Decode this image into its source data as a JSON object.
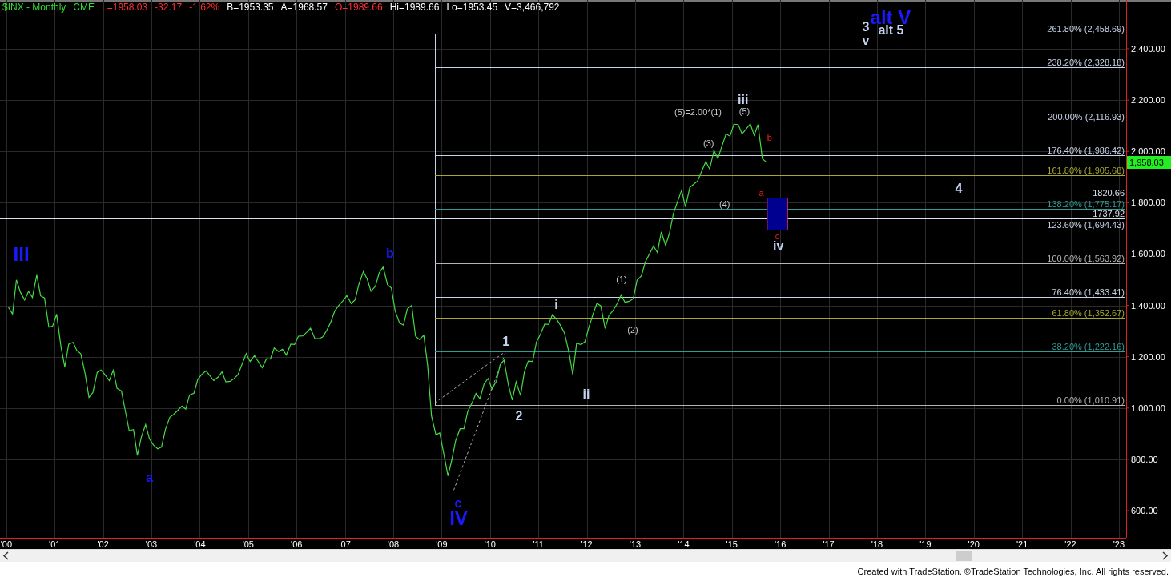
{
  "header": {
    "items": [
      {
        "text": "$INX - Monthly",
        "color": "#33dd33"
      },
      {
        "text": "CME",
        "color": "#33dd33"
      },
      {
        "text": "L=1958.03",
        "color": "#ff3030"
      },
      {
        "text": "-32.17",
        "color": "#ff3030"
      },
      {
        "text": "-1.62%",
        "color": "#ff3030"
      },
      {
        "text": "B=1953.35",
        "color": "#ffffff"
      },
      {
        "text": "A=1968.57",
        "color": "#ffffff"
      },
      {
        "text": "O=1989.66",
        "color": "#ff3030"
      },
      {
        "text": "Hi=1989.66",
        "color": "#ffffff"
      },
      {
        "text": "Lo=1953.45",
        "color": "#ffffff"
      },
      {
        "text": "V=3,466,792",
        "color": "#ffffff"
      }
    ]
  },
  "chart": {
    "chart_data": {
      "type": "line",
      "xlim": [
        1999.87,
        2023.15
      ],
      "ylim": [
        494,
        2590
      ],
      "x": [
        2000.04,
        2000.13,
        2000.21,
        2000.29,
        2000.38,
        2000.46,
        2000.54,
        2000.63,
        2000.71,
        2000.79,
        2000.88,
        2000.96,
        2001.04,
        2001.13,
        2001.21,
        2001.29,
        2001.38,
        2001.46,
        2001.54,
        2001.63,
        2001.71,
        2001.79,
        2001.88,
        2001.96,
        2002.04,
        2002.13,
        2002.21,
        2002.29,
        2002.38,
        2002.46,
        2002.54,
        2002.63,
        2002.71,
        2002.79,
        2002.88,
        2002.96,
        2003.04,
        2003.13,
        2003.21,
        2003.29,
        2003.38,
        2003.46,
        2003.54,
        2003.63,
        2003.71,
        2003.79,
        2003.88,
        2003.96,
        2004.04,
        2004.13,
        2004.21,
        2004.29,
        2004.38,
        2004.46,
        2004.54,
        2004.63,
        2004.71,
        2004.79,
        2004.88,
        2004.96,
        2005.04,
        2005.13,
        2005.21,
        2005.29,
        2005.38,
        2005.46,
        2005.54,
        2005.63,
        2005.71,
        2005.79,
        2005.88,
        2005.96,
        2006.04,
        2006.13,
        2006.21,
        2006.29,
        2006.38,
        2006.46,
        2006.54,
        2006.63,
        2006.71,
        2006.79,
        2006.88,
        2006.96,
        2007.04,
        2007.13,
        2007.21,
        2007.29,
        2007.38,
        2007.46,
        2007.54,
        2007.63,
        2007.71,
        2007.79,
        2007.88,
        2007.96,
        2008.04,
        2008.13,
        2008.21,
        2008.29,
        2008.38,
        2008.46,
        2008.54,
        2008.63,
        2008.71,
        2008.79,
        2008.88,
        2008.96,
        2009.04,
        2009.13,
        2009.21,
        2009.29,
        2009.38,
        2009.46,
        2009.54,
        2009.63,
        2009.71,
        2009.79,
        2009.88,
        2009.96,
        2010.04,
        2010.13,
        2010.21,
        2010.29,
        2010.38,
        2010.46,
        2010.54,
        2010.63,
        2010.71,
        2010.79,
        2010.88,
        2010.96,
        2011.04,
        2011.13,
        2011.21,
        2011.29,
        2011.38,
        2011.46,
        2011.54,
        2011.63,
        2011.71,
        2011.79,
        2011.88,
        2011.96,
        2012.04,
        2012.13,
        2012.21,
        2012.29,
        2012.38,
        2012.46,
        2012.54,
        2012.63,
        2012.71,
        2012.79,
        2012.88,
        2012.96,
        2013.04,
        2013.13,
        2013.21,
        2013.29,
        2013.38,
        2013.46,
        2013.54,
        2013.63,
        2013.71,
        2013.79,
        2013.88,
        2013.96,
        2014.04,
        2014.13,
        2014.21,
        2014.29,
        2014.38,
        2014.46,
        2014.54,
        2014.63,
        2014.71,
        2014.79,
        2014.88,
        2014.96,
        2015.04,
        2015.13,
        2015.21,
        2015.29,
        2015.38,
        2015.46,
        2015.54,
        2015.63,
        2015.71
      ],
      "xticks": [
        {
          "value": 2000,
          "label": "'00"
        },
        {
          "value": 2001,
          "label": "'01"
        },
        {
          "value": 2002,
          "label": "'02"
        },
        {
          "value": 2003,
          "label": "'03"
        },
        {
          "value": 2004,
          "label": "'04"
        },
        {
          "value": 2005,
          "label": "'05"
        },
        {
          "value": 2006,
          "label": "'06"
        },
        {
          "value": 2007,
          "label": "'07"
        },
        {
          "value": 2008,
          "label": "'08"
        },
        {
          "value": 2009,
          "label": "'09"
        },
        {
          "value": 2010,
          "label": "'10"
        },
        {
          "value": 2011,
          "label": "'11"
        },
        {
          "value": 2012,
          "label": "'12"
        },
        {
          "value": 2013,
          "label": "'13"
        },
        {
          "value": 2014,
          "label": "'14"
        },
        {
          "value": 2015,
          "label": "'15"
        },
        {
          "value": 2016,
          "label": "'16"
        },
        {
          "value": 2017,
          "label": "'17"
        },
        {
          "value": 2018,
          "label": "'18"
        },
        {
          "value": 2019,
          "label": "'19"
        },
        {
          "value": 2020,
          "label": "'20"
        },
        {
          "value": 2021,
          "label": "'21"
        },
        {
          "value": 2022,
          "label": "'22"
        },
        {
          "value": 2023,
          "label": "'23"
        }
      ],
      "yticks": [
        {
          "value": 600,
          "label": "600.00"
        },
        {
          "value": 800,
          "label": "800.00"
        },
        {
          "value": 1000,
          "label": "1,000.00"
        },
        {
          "value": 1200,
          "label": "1,200.00"
        },
        {
          "value": 1400,
          "label": "1,400.00"
        },
        {
          "value": 1600,
          "label": "1,600.00"
        },
        {
          "value": 1800,
          "label": "1,800.00"
        },
        {
          "value": 2000,
          "label": "2,000.00"
        },
        {
          "value": 2200,
          "label": "2,200.00"
        },
        {
          "value": 2400,
          "label": "2,400.00"
        }
      ],
      "series": [
        {
          "color": "#44dd44",
          "values": [
            1394,
            1366,
            1499,
            1452,
            1421,
            1455,
            1431,
            1518,
            1437,
            1429,
            1315,
            1320,
            1366,
            1240,
            1160,
            1249,
            1256,
            1224,
            1211,
            1134,
            1041,
            1060,
            1139,
            1148,
            1130,
            1107,
            1147,
            1076,
            1067,
            990,
            912,
            916,
            815,
            886,
            936,
            880,
            856,
            841,
            848,
            917,
            964,
            975,
            990,
            1008,
            996,
            1051,
            1058,
            1112,
            1131,
            1145,
            1126,
            1107,
            1121,
            1141,
            1102,
            1104,
            1115,
            1130,
            1174,
            1212,
            1181,
            1204,
            1181,
            1157,
            1192,
            1191,
            1234,
            1220,
            1229,
            1207,
            1249,
            1248,
            1280,
            1281,
            1295,
            1311,
            1270,
            1270,
            1277,
            1304,
            1336,
            1378,
            1401,
            1418,
            1438,
            1407,
            1421,
            1482,
            1531,
            1503,
            1455,
            1474,
            1527,
            1549,
            1481,
            1468,
            1378,
            1331,
            1323,
            1386,
            1400,
            1280,
            1267,
            1283,
            1166,
            969,
            896,
            903,
            826,
            735,
            798,
            873,
            919,
            919,
            987,
            1021,
            1057,
            1036,
            1096,
            1115,
            1074,
            1104,
            1169,
            1187,
            1089,
            1031,
            1102,
            1049,
            1141,
            1183,
            1181,
            1258,
            1286,
            1327,
            1326,
            1364,
            1345,
            1321,
            1292,
            1219,
            1131,
            1253,
            1247,
            1258,
            1312,
            1366,
            1408,
            1398,
            1310,
            1362,
            1379,
            1407,
            1441,
            1412,
            1416,
            1426,
            1498,
            1515,
            1569,
            1598,
            1631,
            1606,
            1686,
            1633,
            1682,
            1757,
            1806,
            1848,
            1783,
            1859,
            1872,
            1884,
            1924,
            1960,
            1931,
            2003,
            1972,
            2018,
            2068,
            2059,
            2105,
            2105,
            2068,
            2086,
            2107,
            2063,
            2104,
            1972,
            1958
          ]
        }
      ],
      "grid": true,
      "ref_lines": [
        {
          "axis": "y",
          "value": 2458.69,
          "label": "261.80% (2,458.69)",
          "color": "#c8d2e6"
        },
        {
          "axis": "y",
          "value": 2328.18,
          "label": "238.20% (2,328.18)",
          "color": "#c8d2e6"
        },
        {
          "axis": "y",
          "value": 2116.93,
          "label": "200.00% (2,116.93)",
          "color": "#c8d2e6"
        },
        {
          "axis": "y",
          "value": 1986.42,
          "label": "176.40% (1,986.42)",
          "color": "#c8d2e6"
        },
        {
          "axis": "y",
          "value": 1905.68,
          "label": "161.80% (1,905.68)",
          "color": "#a8a830"
        },
        {
          "axis": "y",
          "value": 1820.66,
          "label": "1820.66",
          "color": "#d8e0ee"
        },
        {
          "axis": "y",
          "value": 1775.17,
          "label": "138.20% (1,775.17)",
          "color": "#2e9c94"
        },
        {
          "axis": "y",
          "value": 1737.92,
          "label": "1737.92",
          "color": "#d8e0ee"
        },
        {
          "axis": "y",
          "value": 1694.43,
          "label": "123.60% (1,694.43)",
          "color": "#c8d2e6"
        },
        {
          "axis": "y",
          "value": 1563.92,
          "label": "100.00% (1,563.92)",
          "color": "#b4b4b4"
        },
        {
          "axis": "y",
          "value": 1433.41,
          "label": "76.40% (1,433.41)",
          "color": "#c8d2e6"
        },
        {
          "axis": "y",
          "value": 1352.67,
          "label": "61.80% (1,352.67)",
          "color": "#a8a830"
        },
        {
          "axis": "y",
          "value": 1222.16,
          "label": "38.20% (1,222.16)",
          "color": "#2e9c94"
        },
        {
          "axis": "y",
          "value": 1010.91,
          "label": "0.00% (1,010.91)",
          "color": "#b4b4b4"
        },
        {
          "axis": "x",
          "value": 2008.86,
          "color": "#c8d2e6"
        }
      ],
      "annotations": [
        "III",
        "b",
        "a",
        "c",
        "IV",
        "1",
        "2",
        "i",
        "ii",
        "(1)",
        "(2)",
        "(5)=2.00*(1)",
        "(3)",
        "(4)",
        "iii",
        "(5)",
        "b",
        "a",
        "c",
        "iv",
        "3",
        "v",
        "alt V",
        "alt 5",
        "4"
      ]
    },
    "price_tag": {
      "text": "1,958.03"
    }
  },
  "footer": {
    "text": "Created with TradeStation. ©TradeStation Technologies, Inc. All rights reserved."
  }
}
